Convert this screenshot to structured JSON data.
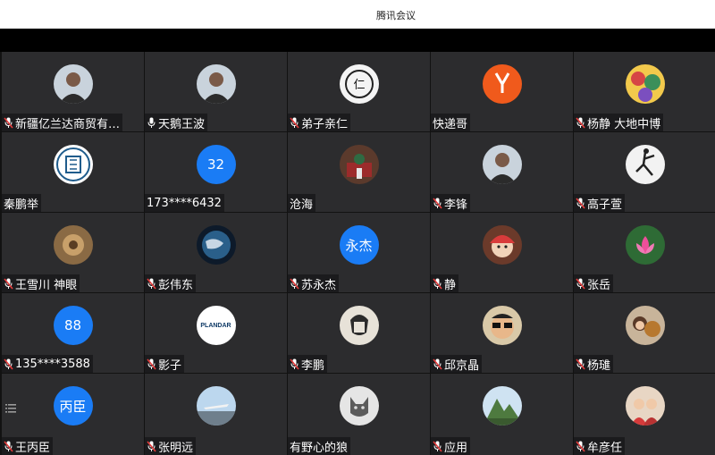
{
  "window": {
    "title": "腾讯会议"
  },
  "participants": [
    {
      "name": "新疆亿兰达商贸有…",
      "mic": "muted",
      "avatar": "photo-person"
    },
    {
      "name": "天鹅王波",
      "mic": "on",
      "avatar": "photo-person"
    },
    {
      "name": "弟子亲仁",
      "mic": "muted",
      "avatar": "calligraphy-logo"
    },
    {
      "name": "快递哥",
      "mic": "none",
      "avatar": "courier-logo"
    },
    {
      "name": "杨静 大地中博",
      "mic": "muted",
      "avatar": "photo-colorful"
    },
    {
      "name": "秦鹏举",
      "mic": "none",
      "avatar": "seal-logo"
    },
    {
      "name": "173****6432",
      "mic": "none",
      "avatar": "text",
      "avatar_text": "32"
    },
    {
      "name": "沧海",
      "mic": "none",
      "avatar": "photo-scene"
    },
    {
      "name": "李锋",
      "mic": "muted",
      "avatar": "photo-person"
    },
    {
      "name": "高子萱",
      "mic": "muted",
      "avatar": "photo-dancer"
    },
    {
      "name": "王雪川 神眼",
      "mic": "muted",
      "avatar": "photo-object"
    },
    {
      "name": "彭伟东",
      "mic": "muted",
      "avatar": "photo-earth"
    },
    {
      "name": "苏永杰",
      "mic": "muted",
      "avatar": "text",
      "avatar_text": "永杰"
    },
    {
      "name": "静",
      "mic": "muted",
      "avatar": "photo-cartoon"
    },
    {
      "name": "张岳",
      "mic": "muted",
      "avatar": "photo-lotus"
    },
    {
      "name": "135****3588",
      "mic": "muted",
      "avatar": "text",
      "avatar_text": "88"
    },
    {
      "name": "影子",
      "mic": "muted",
      "avatar": "plandar-logo",
      "avatar_logo_text": "PLANDAR"
    },
    {
      "name": "李鹏",
      "mic": "muted",
      "avatar": "photo-sketch"
    },
    {
      "name": "邱京晶",
      "mic": "muted",
      "avatar": "photo-sunglasses"
    },
    {
      "name": "杨璡",
      "mic": "muted",
      "avatar": "photo-person-dog"
    },
    {
      "name": "王丙臣",
      "mic": "muted",
      "avatar": "text",
      "avatar_text": "丙臣"
    },
    {
      "name": "张明远",
      "mic": "muted",
      "avatar": "photo-airplane"
    },
    {
      "name": "有野心的狼",
      "mic": "none",
      "avatar": "photo-wolf"
    },
    {
      "name": "应用",
      "mic": "muted",
      "avatar": "photo-mountain"
    },
    {
      "name": "牟彦任",
      "mic": "muted",
      "avatar": "photo-group"
    }
  ],
  "colors": {
    "tile_bg": "#2c2c2e",
    "grid_bg": "#121212",
    "avatar_blue": "#1a7cf5",
    "mic_muted_red": "#e33b3b"
  }
}
